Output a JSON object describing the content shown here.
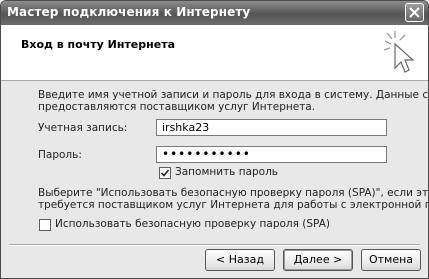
{
  "window": {
    "title": "Мастер подключения к Интернету",
    "close_glyph": "✕"
  },
  "header": {
    "title": "Вход в почту Интернета",
    "icon": "sparkle-cursor-icon"
  },
  "form": {
    "intro_line1": "Введите имя учетной записи и пароль для входа в систему. Данные сведения",
    "intro_line2": "предоставляются поставщиком услуг Интернета.",
    "account_label": "Учетная запись:",
    "account_value": "irshka23",
    "password_label": "Пароль:",
    "password_value": "•••••••••••",
    "remember_label": "Запомнить пароль",
    "remember_checked": true,
    "spa_note_line1": "Выберите \"Использовать безопасную проверку пароля (SPA)\", если это",
    "spa_note_line2": "требуется поставщиком услуг Интернета для работы с электронной почтой.",
    "spa_label": "Использовать безопасную проверку пароля (SPA)",
    "spa_checked": false
  },
  "buttons": {
    "back": "< Назад",
    "next": "Далее >",
    "cancel": "Отмена"
  }
}
